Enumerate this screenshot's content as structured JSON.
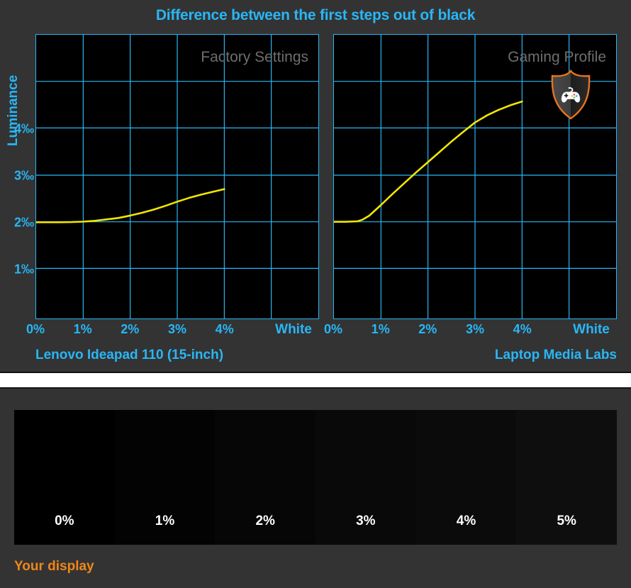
{
  "colors": {
    "accent_cyan": "#29b6f6",
    "curve_yellow": "#f2e600",
    "panel_bg": "#333333",
    "plot_bg": "#000000",
    "watermark_gray": "#6e6e6e",
    "your_display_orange": "#f0861a",
    "badge_orange": "#e8731c"
  },
  "top_panel": {
    "title": "Difference between the first steps out of black",
    "y_axis_title": "Luminance",
    "y_ticks": [
      "4‰",
      "3‰",
      "2‰",
      "1‰"
    ],
    "x_ticks": [
      "0%",
      "1%",
      "2%",
      "3%",
      "4%",
      "White"
    ],
    "left": {
      "watermark": "Factory Settings",
      "caption": "Lenovo Ideapad 110 (15-inch)"
    },
    "right": {
      "watermark": "Gaming Profile",
      "caption": "Laptop Media Labs",
      "badge_icon": "gamepad-shield-icon"
    }
  },
  "bottom_panel": {
    "caption": "Your display",
    "band_labels": [
      "0%",
      "1%",
      "2%",
      "3%",
      "4%",
      "5%"
    ],
    "band_colors": [
      "#000000",
      "#030303",
      "#060606",
      "#090909",
      "#0b0b0b",
      "#0e0e0e"
    ]
  },
  "chart_data": [
    {
      "type": "line",
      "title": "Difference between the first steps out of black",
      "subtitle": "Factory Settings",
      "series_name": "Lenovo Ideapad 110 (15-inch) — Factory Settings",
      "xlabel": "",
      "ylabel": "Luminance",
      "x_tick_labels": [
        "0%",
        "1%",
        "2%",
        "3%",
        "4%",
        "White"
      ],
      "y_tick_labels": [
        "1‰",
        "2‰",
        "3‰",
        "4‰"
      ],
      "xlim": [
        0,
        5
      ],
      "ylim": [
        0,
        6.09
      ],
      "grid": true,
      "legend": "none",
      "line_color": "#f2e600",
      "x": [
        0,
        0.25,
        0.5,
        0.75,
        1.0,
        1.25,
        1.5,
        1.75,
        2.0,
        2.25,
        2.5,
        2.75,
        3.0,
        3.25,
        3.5,
        3.75,
        4.0
      ],
      "y": [
        2.11,
        2.11,
        2.11,
        2.11,
        2.12,
        2.14,
        2.17,
        2.2,
        2.25,
        2.31,
        2.38,
        2.46,
        2.55,
        2.63,
        2.7,
        2.76,
        2.82
      ]
    },
    {
      "type": "line",
      "title": "Difference between the first steps out of black",
      "subtitle": "Gaming Profile",
      "series_name": "Lenovo Ideapad 110 (15-inch) — Gaming Profile",
      "xlabel": "",
      "ylabel": "Luminance",
      "x_tick_labels": [
        "0%",
        "1%",
        "2%",
        "3%",
        "4%",
        "White"
      ],
      "y_tick_labels": [
        "1‰",
        "2‰",
        "3‰",
        "4‰"
      ],
      "xlim": [
        0,
        5
      ],
      "ylim": [
        0,
        6.09
      ],
      "grid": true,
      "legend": "none",
      "line_color": "#f2e600",
      "x": [
        0,
        0.25,
        0.5,
        0.6,
        0.75,
        1.0,
        1.25,
        1.5,
        1.75,
        2.0,
        2.25,
        2.5,
        2.75,
        3.0,
        3.25,
        3.5,
        3.75,
        4.0
      ],
      "y": [
        2.12,
        2.12,
        2.13,
        2.16,
        2.25,
        2.48,
        2.72,
        2.95,
        3.18,
        3.4,
        3.62,
        3.84,
        4.05,
        4.25,
        4.4,
        4.52,
        4.62,
        4.7
      ]
    }
  ]
}
